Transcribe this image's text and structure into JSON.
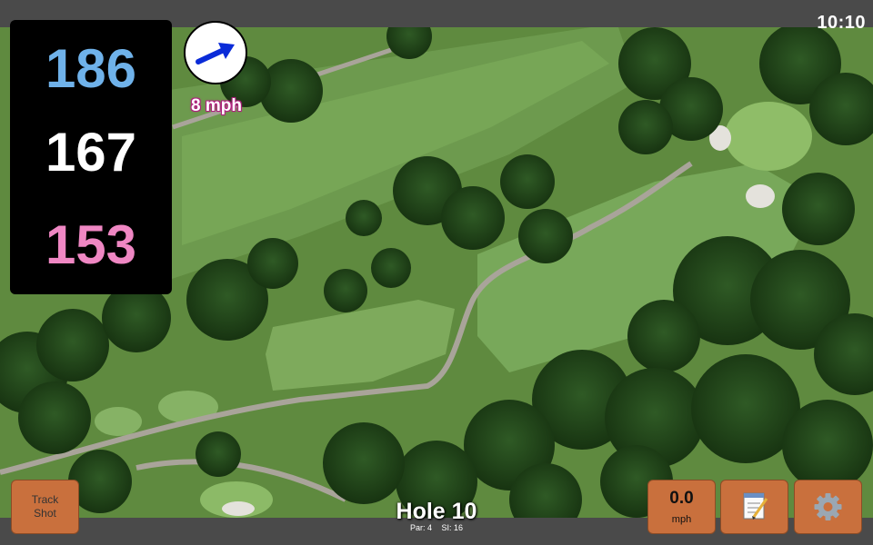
{
  "clock": "10:10",
  "distances": {
    "back": "186",
    "middle": "167",
    "front": "153"
  },
  "wind": {
    "speed": "8 mph",
    "direction": "arrow pointing east-north-east",
    "icon": "wind-arrow-icon"
  },
  "hole": {
    "title": "Hole 10",
    "par": "Par: 4",
    "stroke_index": "SI: 16"
  },
  "buttons": {
    "track_shot": {
      "line1": "Track",
      "line2": "Shot"
    },
    "speed": {
      "value": "0.0",
      "unit": "mph"
    },
    "notes": {
      "icon": "notepad-icon"
    },
    "settings": {
      "icon": "gear-icon"
    }
  },
  "colors": {
    "back_distance": "#6fb2ea",
    "middle_distance": "#ffffff",
    "front_distance": "#ef87c3",
    "button": "#c9703d",
    "bar": "#4a4a4a"
  }
}
